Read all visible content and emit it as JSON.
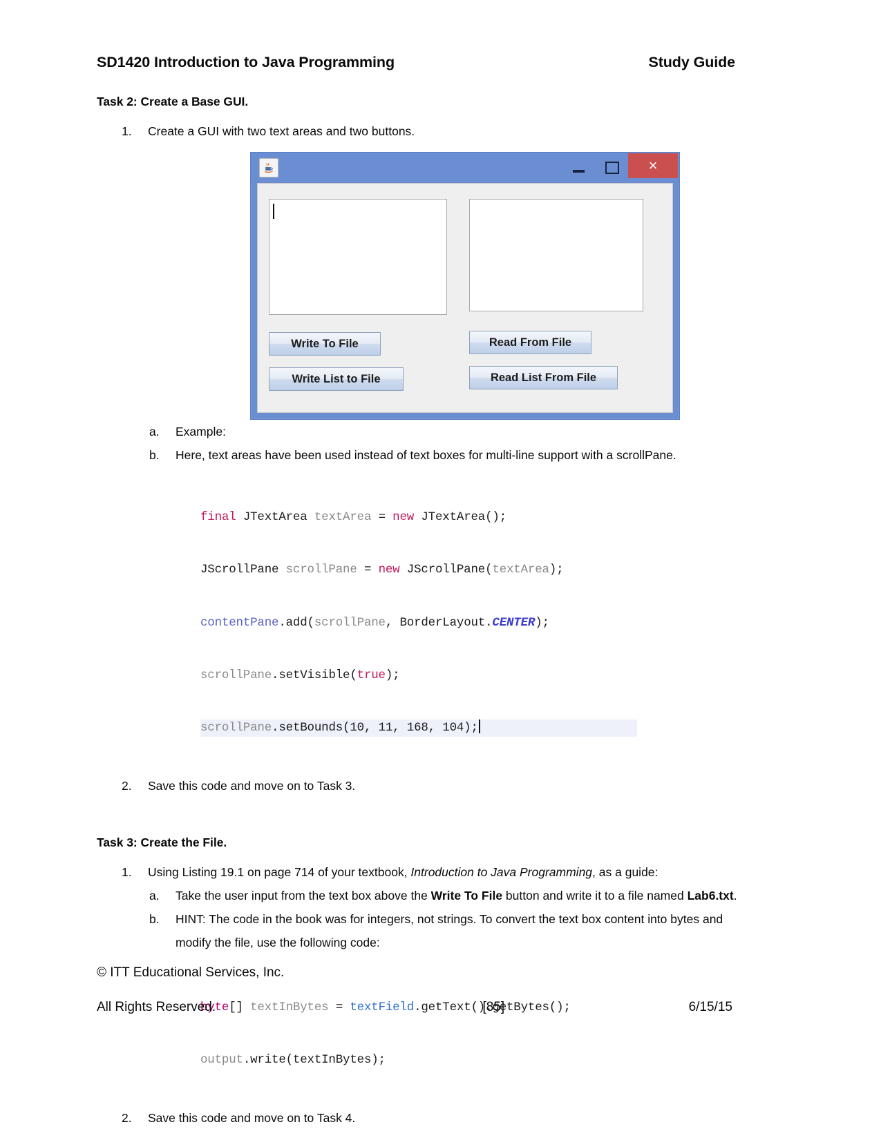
{
  "header": {
    "course_title": "SD1420 Introduction to Java Programming",
    "doc_type": "Study Guide"
  },
  "task2": {
    "heading": "Task 2: Create a Base GUI.",
    "item1": "Create a GUI with two text areas and two buttons.",
    "sub_a": "Example:",
    "sub_b": "Here, text areas have been used instead of text boxes for multi-line support with a scrollPane.",
    "item2": "Save this code and move on to Task 3."
  },
  "gui_mock": {
    "window_icon": "java-cup-icon",
    "minimize_label": "minimize-icon",
    "maximize_label": "maximize-icon",
    "close_label": "×",
    "buttons": {
      "write_to_file": "Write To File",
      "write_list_to_file": "Write List to File",
      "read_from_file": "Read From File",
      "read_list_from_file": "Read List From File"
    },
    "titlebar_color": "#6a8ed1",
    "close_color": "#c9504f",
    "client_color": "#efefef"
  },
  "code1": {
    "line1": {
      "kw_final": "final",
      "type1": " JTextArea ",
      "var1": "textArea",
      "eq": " = ",
      "kw_new": "new",
      "rest": " JTextArea();"
    },
    "line2": {
      "type1": "JScrollPane ",
      "var1": "scrollPane",
      "eq": " = ",
      "kw_new": "new",
      "mid": " JScrollPane(",
      "arg": "textArea",
      "end": ");"
    },
    "line3": {
      "obj": "contentPane",
      "mid": ".add(",
      "arg1": "scrollPane",
      "sep": ", BorderLayout.",
      "const": "CENTER",
      "end": ");"
    },
    "line4": {
      "obj": "scrollPane",
      "mid": ".setVisible(",
      "bool": "true",
      "end": ");"
    },
    "line5": {
      "obj": "scrollPane",
      "mid": ".setBounds(10, 11, 168, 104);"
    }
  },
  "task3": {
    "heading": "Task 3: Create the File.",
    "item1_pre": "Using Listing 19.1 on page 714 of your textbook, ",
    "item1_italic": "Introduction to Java Programming",
    "item1_post": ", as a guide:",
    "sub_a_pre": "Take the user input from the text box above the ",
    "sub_a_bold1": "Write To File",
    "sub_a_mid": " button and write it to a file named ",
    "sub_a_bold2": "Lab6.txt",
    "sub_a_post": ".",
    "sub_b": "HINT: The code in the book was for integers, not strings. To convert the text box content into bytes and modify the file, use the following code:",
    "item2": "Save this code and move on to Task 4."
  },
  "code2": {
    "line1": {
      "kw_byte": "byte",
      "brackets": "[] ",
      "var": "textInBytes",
      "eq": " = ",
      "field": "textField",
      "rest": ".getText().getBytes();"
    },
    "line2": {
      "obj": "output",
      "rest": ".write(textInBytes);"
    }
  },
  "footer": {
    "line1": "© ITT Educational Services, Inc.",
    "rights": "All Rights Reserved.",
    "page_number": "[85]",
    "date": "6/15/15"
  }
}
